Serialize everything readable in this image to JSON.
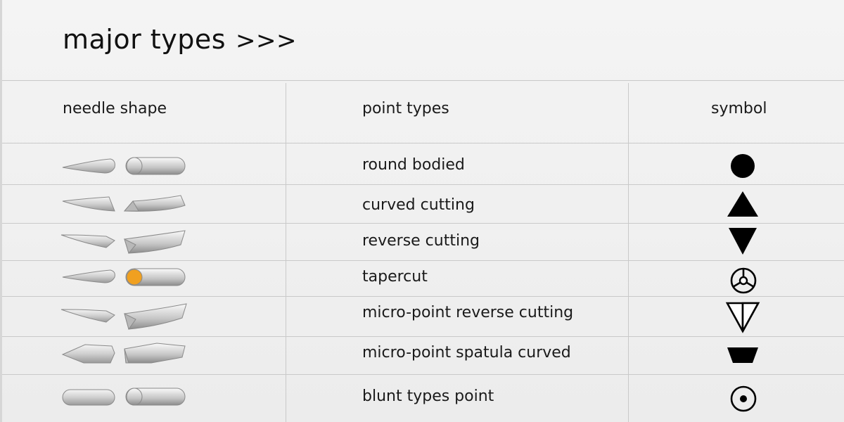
{
  "title": "major types",
  "title_arrows": ">>>",
  "headers": {
    "needle_shape": "needle shape",
    "point_types": "point types",
    "symbol": "symbol"
  },
  "rows": [
    {
      "label": "round bodied",
      "symbol_icon": "filled-circle-icon"
    },
    {
      "label": "curved cutting",
      "symbol_icon": "filled-up-triangle-icon"
    },
    {
      "label": "reverse cutting",
      "symbol_icon": "filled-down-triangle-icon"
    },
    {
      "label": "tapercut",
      "symbol_icon": "circle-y-icon"
    },
    {
      "label": "micro-point reverse cutting",
      "symbol_icon": "down-triangle-outline-icon"
    },
    {
      "label": "micro-point spatula curved",
      "symbol_icon": "trapezoid-icon"
    },
    {
      "label": "blunt types point",
      "symbol_icon": "dot-circle-icon"
    }
  ],
  "colors": {
    "accent": "#f0a020",
    "line": "#c9c9c9",
    "text": "#1a1a1a"
  }
}
